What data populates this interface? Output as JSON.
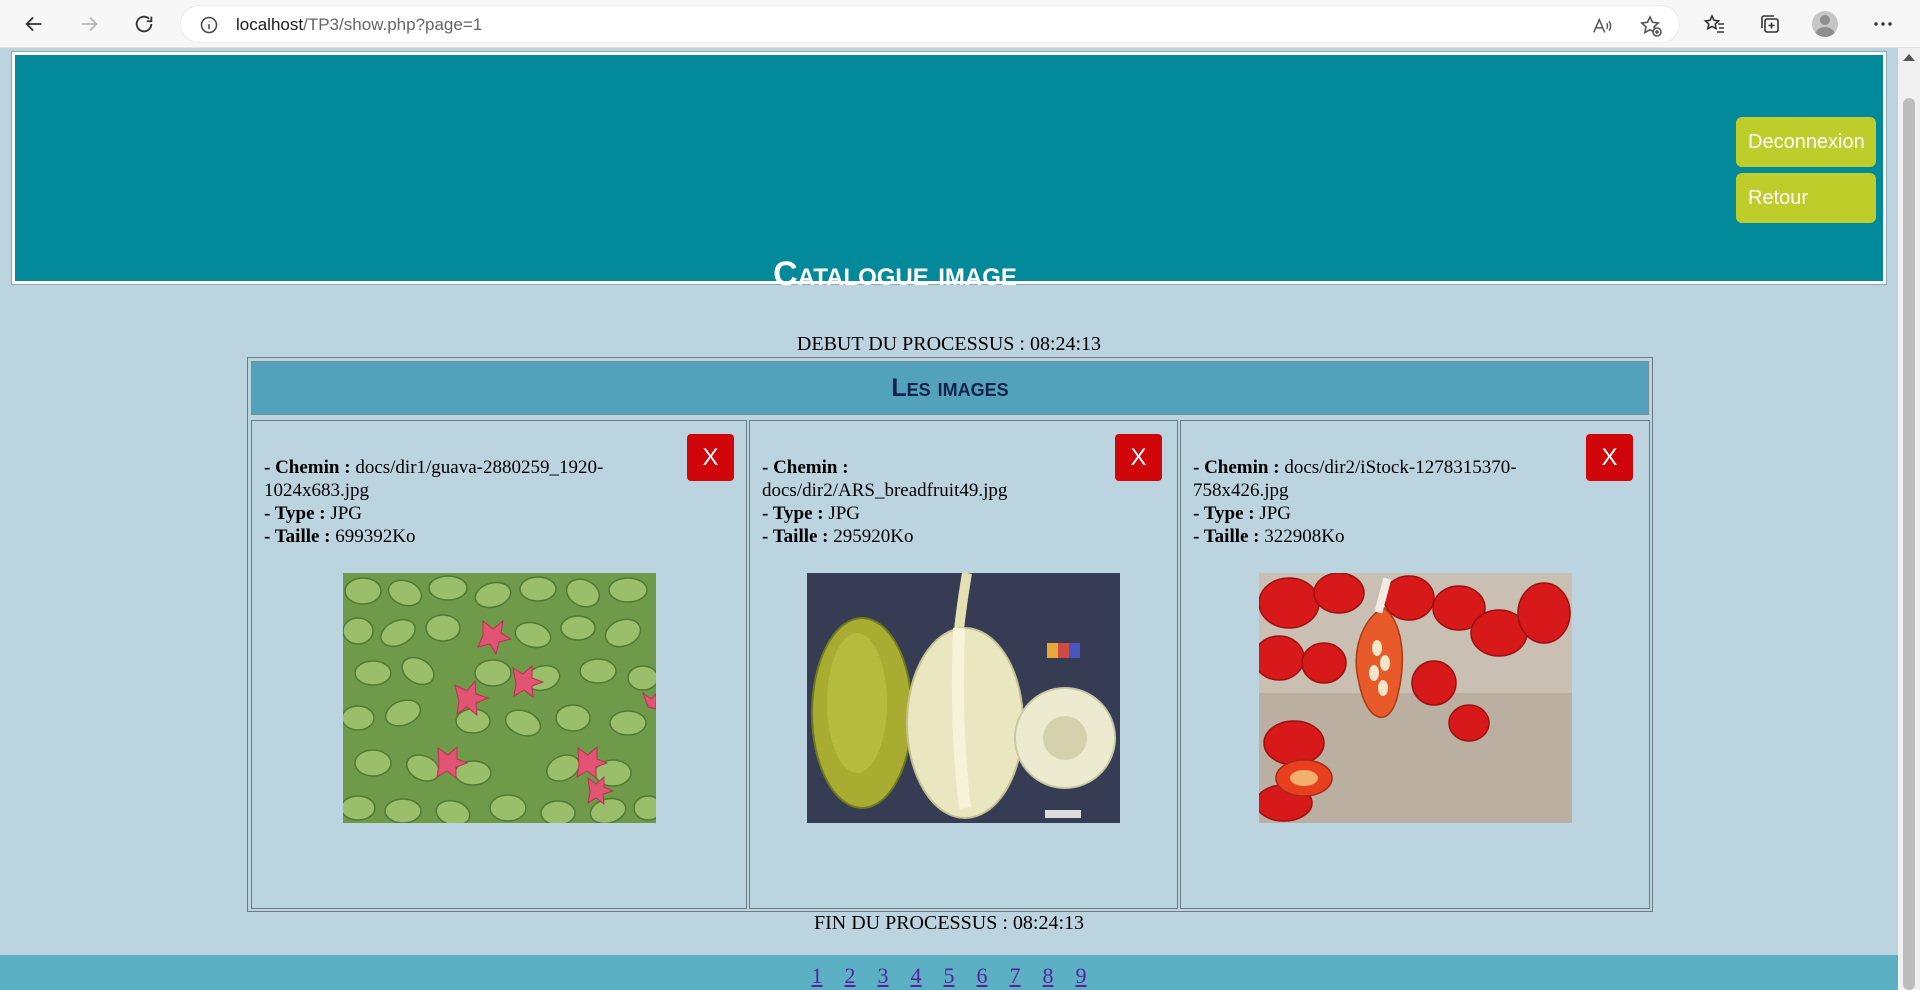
{
  "browser": {
    "url_host": "localhost",
    "url_path": "/TP3/show.php?page=1"
  },
  "header": {
    "title": "Catalogue image",
    "logout_label": "Deconnexion",
    "back_label": "Retour",
    "bg_color": "#028a9a",
    "button_color": "#bfcd2a"
  },
  "process": {
    "start": "DEBUT DU PROCESSUS : 08:24:13",
    "end": "FIN DU PROCESSUS : 08:24:13"
  },
  "table": {
    "caption": "Les images",
    "label_path": "- Chemin :",
    "label_type": "- Type :",
    "label_size": "- Taille :",
    "delete_label": "X",
    "delete_color": "#d0060a",
    "images": [
      {
        "path_line1": "docs/dir1/guava-2880259_1920-",
        "path_line2": "1024x683.jpg",
        "type": "JPG",
        "size": "699392Ko",
        "thumbnail": "guava-photo"
      },
      {
        "path_line1": "",
        "path_line2": "docs/dir2/ARS_breadfruit49.jpg",
        "type": "JPG",
        "size": "295920Ko",
        "thumbnail": "breadfruit-photo"
      },
      {
        "path_line1": "docs/dir2/iStock-1278315370-",
        "path_line2": "758x426.jpg",
        "type": "JPG",
        "size": "322908Ko",
        "thumbnail": "rosehip-photo"
      }
    ]
  },
  "pagination": {
    "pages": [
      "1",
      "2",
      "3",
      "4",
      "5",
      "6",
      "7",
      "8",
      "9"
    ],
    "link_color": "#5b1ea0"
  }
}
